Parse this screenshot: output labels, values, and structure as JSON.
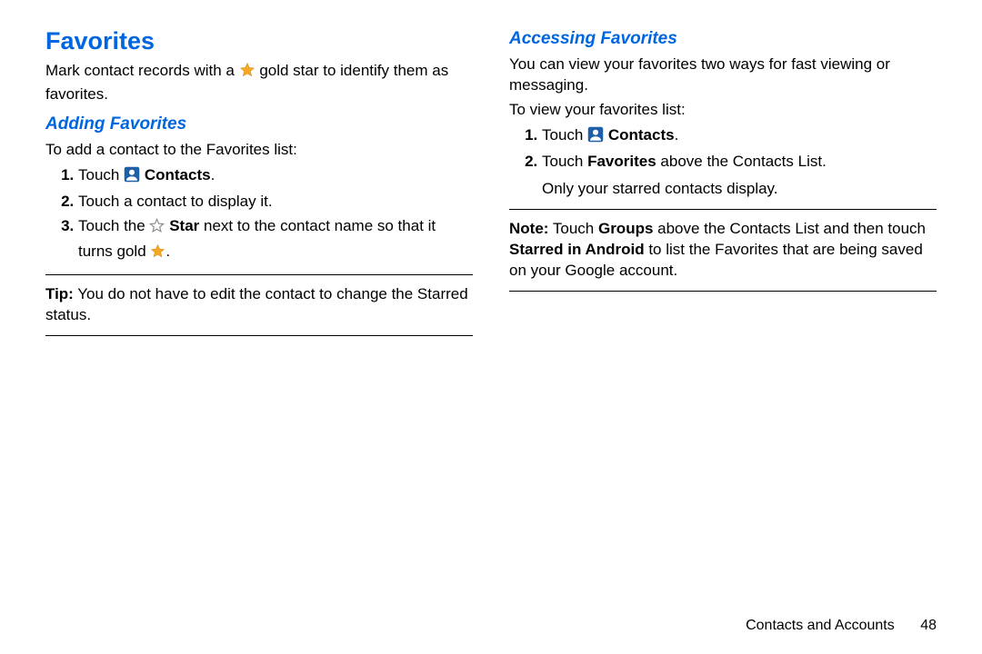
{
  "left": {
    "heading": "Favorites",
    "intro_a": "Mark contact records with a ",
    "intro_b": " gold star to identify them as favorites.",
    "sub": "Adding Favorites",
    "lead": "To add a contact to the Favorites list:",
    "s1_a": "Touch ",
    "s1_b": "Contacts",
    "s1_c": ".",
    "s2": "Touch a contact to display it.",
    "s3_a": "Touch the ",
    "s3_b": "Star",
    "s3_c": " next to the contact name so that it turns gold ",
    "s3_d": ".",
    "tip_lbl": "Tip:",
    "tip_txt": " You do not have to edit the contact to change the Starred status."
  },
  "right": {
    "sub": "Accessing Favorites",
    "intro": "You can view your favorites two ways for fast viewing or messaging.",
    "lead": "To view your favorites list:",
    "s1_a": "Touch ",
    "s1_b": "Contacts",
    "s1_c": ".",
    "s2_a": "Touch ",
    "s2_b": "Favorites",
    "s2_c": " above the Contacts List.",
    "s2_cont": "Only your starred contacts display.",
    "note_lbl": "Note:",
    "note_a": " Touch ",
    "note_b": "Groups",
    "note_c": " above the Contacts List and then touch ",
    "note_d": "Starred in Android",
    "note_e": " to list the Favorites that are being saved on your Google account."
  },
  "footer": {
    "section": "Contacts and Accounts",
    "page": "48"
  },
  "icons": {
    "gold_star": "star-gold-icon",
    "outline_star": "star-outline-icon",
    "contacts": "contacts-icon"
  }
}
